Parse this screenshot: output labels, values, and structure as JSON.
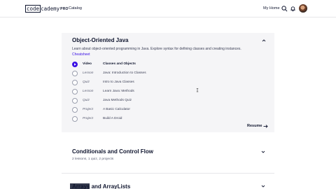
{
  "nav": {
    "logo_code": "code",
    "logo_cademy": "cademy",
    "logo_pro": "PRO",
    "catalog": "Catalog",
    "my_home": "My Home"
  },
  "module1": {
    "title": "Object-Oriented Java",
    "description": "Learn about object-oriented programming in Java. Explore syntax for defining classes and creating instances.",
    "cheatsheet": "Cheatsheet",
    "items": [
      {
        "type": "Video",
        "name": "Classes and Objects",
        "active": true
      },
      {
        "type": "Lesson",
        "name": "Java: Introduction to Classes",
        "active": false
      },
      {
        "type": "Quiz",
        "name": "Intro to Java Classes",
        "active": false
      },
      {
        "type": "Lesson",
        "name": "Learn Java: Methods",
        "active": false
      },
      {
        "type": "Quiz",
        "name": "Java Methods Quiz",
        "active": false
      },
      {
        "type": "Project",
        "name": "A Basic Calculator",
        "active": false
      },
      {
        "type": "Project",
        "name": "Build A Droid",
        "active": false
      }
    ],
    "resume": "Resume"
  },
  "module2": {
    "title": "Conditionals and Control Flow",
    "meta": "2 lessons, 1 quiz, 2 projects"
  },
  "module3": {
    "title": "Arrays and ArrayLists"
  },
  "colors": {
    "accent": "#3a10e5",
    "text": "#10162f",
    "card": "#f5f5f7"
  },
  "icons": [
    "search-icon",
    "bell-icon",
    "avatar",
    "chevron-up-icon",
    "chevron-down-icon",
    "arrow-right-icon"
  ]
}
